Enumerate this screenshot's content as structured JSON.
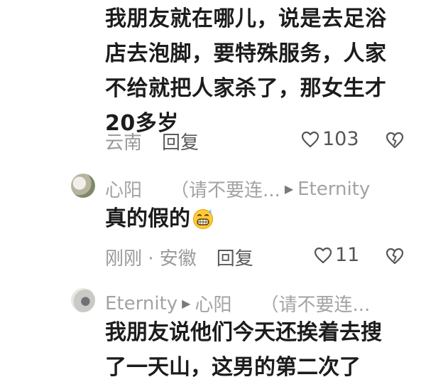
{
  "main_comment": {
    "lines": [
      "我朋友就在哪儿，说是去足浴",
      "店去泡脚，要特殊服务，人家",
      "不给就把人家杀了，那女生才",
      "20多岁"
    ],
    "location": "云南",
    "reply_label": "回复",
    "like_count": "103"
  },
  "reply1": {
    "name": "心阳",
    "quote": "（请不要连...",
    "target": "Eternity",
    "text": "真的假的",
    "emoji": "grimacing-sweat-emoji",
    "time_location": "刚刚 · 安徽",
    "reply_label": "回复",
    "like_count": "11"
  },
  "reply2": {
    "name": "Eternity",
    "target": "心阳",
    "quote": "（请不要连...",
    "lines": [
      "我朋友说他们今天还挨着去搜",
      "了一天山，这男的第二次了"
    ]
  },
  "icons": {
    "like": "heart-outline-icon",
    "dislike": "broken-heart-icon",
    "reply_arrow": "triangle-right-icon"
  }
}
